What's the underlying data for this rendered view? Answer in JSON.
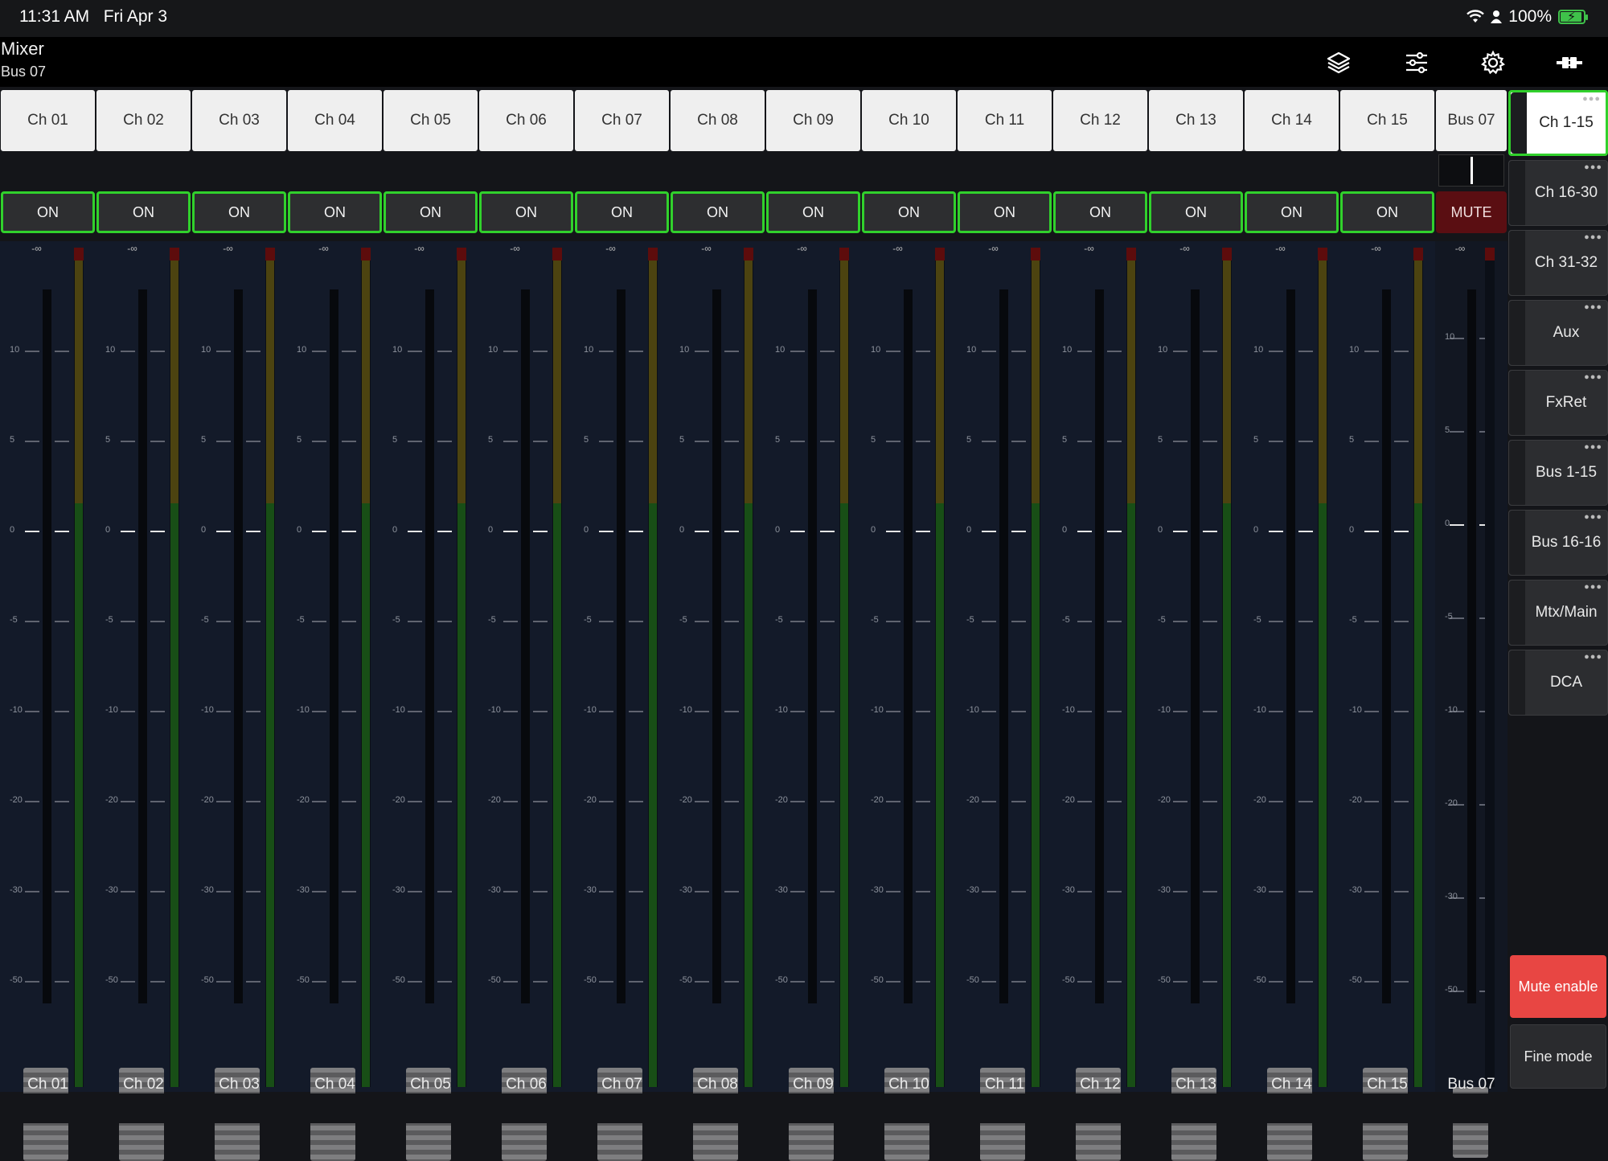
{
  "status_bar": {
    "time": "11:31 AM",
    "date": "Fri Apr 3",
    "battery": "100%"
  },
  "header": {
    "title": "Mixer",
    "subtitle": "Bus 07",
    "icons": [
      "layers-icon",
      "sliders-icon",
      "gear-icon",
      "plug-icon"
    ]
  },
  "scale_labels": [
    "10",
    "5",
    "0",
    "-5",
    "-10",
    "-20",
    "-30",
    "-50"
  ],
  "inf_label": "-∞",
  "channels": [
    {
      "name": "Ch 01",
      "state": "ON"
    },
    {
      "name": "Ch 02",
      "state": "ON"
    },
    {
      "name": "Ch 03",
      "state": "ON"
    },
    {
      "name": "Ch 04",
      "state": "ON"
    },
    {
      "name": "Ch 05",
      "state": "ON"
    },
    {
      "name": "Ch 06",
      "state": "ON"
    },
    {
      "name": "Ch 07",
      "state": "ON"
    },
    {
      "name": "Ch 08",
      "state": "ON"
    },
    {
      "name": "Ch 09",
      "state": "ON"
    },
    {
      "name": "Ch 10",
      "state": "ON"
    },
    {
      "name": "Ch 11",
      "state": "ON"
    },
    {
      "name": "Ch 12",
      "state": "ON"
    },
    {
      "name": "Ch 13",
      "state": "ON"
    },
    {
      "name": "Ch 14",
      "state": "ON"
    },
    {
      "name": "Ch 15",
      "state": "ON"
    }
  ],
  "bus": {
    "name": "Bus 07",
    "state": "MUTE"
  },
  "layers": [
    {
      "label": "Ch 1-15",
      "active": true
    },
    {
      "label": "Ch 16-30",
      "active": false
    },
    {
      "label": "Ch 31-32",
      "active": false
    },
    {
      "label": "Aux",
      "active": false
    },
    {
      "label": "FxRet",
      "active": false
    },
    {
      "label": "Bus 1-15",
      "active": false
    },
    {
      "label": "Bus 16-16",
      "active": false
    },
    {
      "label": "Mtx/Main",
      "active": false
    },
    {
      "label": "DCA",
      "active": false
    }
  ],
  "buttons": {
    "mute_enable": "Mute enable",
    "fine_mode": "Fine mode"
  },
  "colors": {
    "on_border": "#31d12c",
    "mute": "#5a0e12",
    "mute_enable": "#e84643"
  }
}
